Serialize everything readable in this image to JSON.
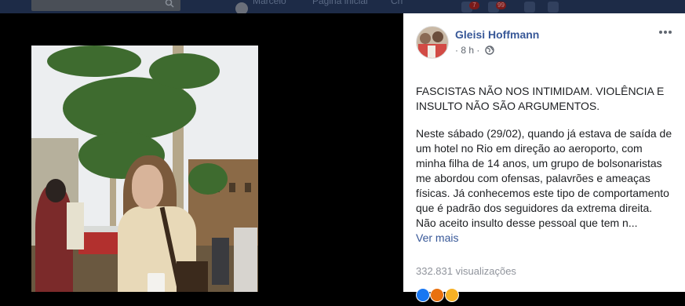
{
  "topbar": {
    "nav_profile": "Marcelo",
    "nav_home": "Página inicial",
    "nav_find": "Cri",
    "badge_friends": "7",
    "badge_notifications": "99"
  },
  "post": {
    "author": "Gleisi Hoffmann",
    "time": "8 h",
    "time_prefix": "·",
    "headline": "FASCISTAS NÃO NOS INTIMIDAM. VIOLÊNCIA E INSULTO NÃO SÃO ARGUMENTOS.",
    "body": "Neste sábado (29/02), quando já estava de saída de um hotel no Rio em direção ao aeroporto, com minha filha de 14 anos, um grupo de bolsonaristas me abordou com ofensas, palavrões e ameaças físicas. Já conhecemos este tipo de comportamento que é padrão dos seguidores da extrema direita. Não aceito insulto desse pessoal que tem n...",
    "see_more": "Ver mais",
    "views": "332.831 visualizações"
  },
  "colors": {
    "link": "#385898",
    "text": "#1c1e21",
    "muted": "#90949c",
    "like": "#1877f2",
    "haha": "#f7b125",
    "angry": "#e9710f"
  },
  "icons": {
    "search": "search-icon",
    "privacy": "globe-icon",
    "options": "more-options-icon"
  }
}
